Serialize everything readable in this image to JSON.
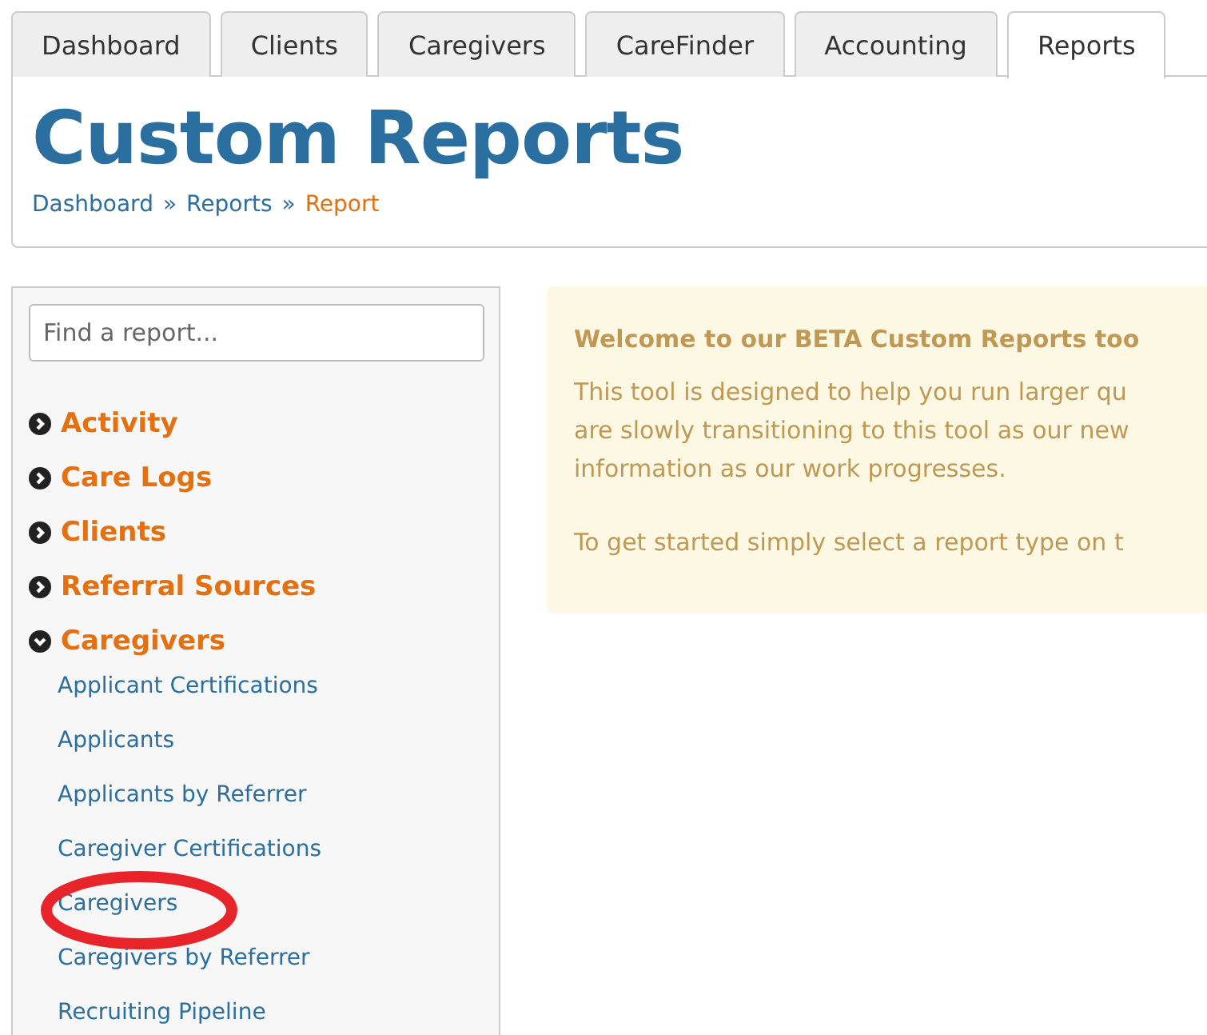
{
  "tabs": [
    {
      "label": "Dashboard",
      "selected": false
    },
    {
      "label": "Clients",
      "selected": false
    },
    {
      "label": "Caregivers",
      "selected": false
    },
    {
      "label": "CareFinder",
      "selected": false
    },
    {
      "label": "Accounting",
      "selected": false
    },
    {
      "label": "Reports",
      "selected": true
    }
  ],
  "header": {
    "title": "Custom Reports",
    "breadcrumb": [
      {
        "label": "Dashboard",
        "current": false
      },
      {
        "label": "Reports",
        "current": false
      },
      {
        "label": "Report",
        "current": true
      }
    ],
    "separator": "»"
  },
  "sidebar": {
    "search": {
      "placeholder": "Find a report..."
    },
    "sections": [
      {
        "label": "Activity",
        "expanded": false
      },
      {
        "label": "Care Logs",
        "expanded": false
      },
      {
        "label": "Clients",
        "expanded": false
      },
      {
        "label": "Referral Sources",
        "expanded": false
      },
      {
        "label": "Caregivers",
        "expanded": true,
        "children": [
          {
            "label": "Applicant Certifications",
            "circled": false
          },
          {
            "label": "Applicants",
            "circled": false
          },
          {
            "label": "Applicants by Referrer",
            "circled": false
          },
          {
            "label": "Caregiver Certifications",
            "circled": false
          },
          {
            "label": "Caregivers",
            "circled": true
          },
          {
            "label": "Caregivers by Referrer",
            "circled": false
          },
          {
            "label": "Recruiting Pipeline",
            "circled": false
          }
        ]
      }
    ]
  },
  "notice": {
    "title": "Welcome to our BETA Custom Reports too",
    "lines": [
      "This tool is designed to help you run larger qu",
      "are slowly transitioning to this tool as our new",
      "information as our work progresses."
    ],
    "footer": "To get started simply select a report type on t"
  }
}
